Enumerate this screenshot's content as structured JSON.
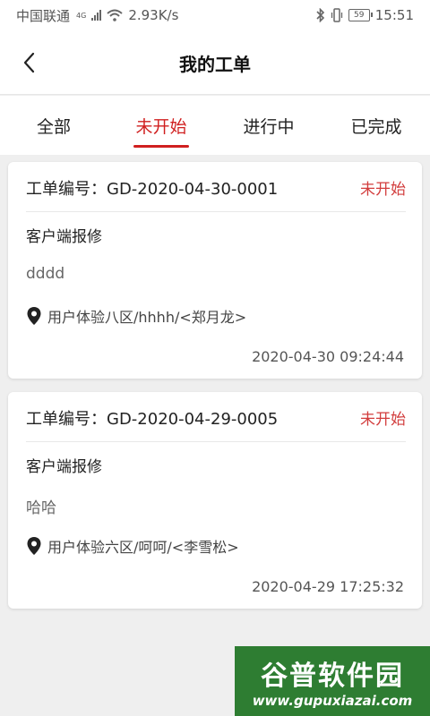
{
  "status_bar": {
    "carrier": "中国联通",
    "network": "4G",
    "speed": "2.93K/s",
    "battery": "59",
    "time": "15:51"
  },
  "header": {
    "title": "我的工单"
  },
  "tabs": [
    {
      "label": "全部",
      "active": false
    },
    {
      "label": "未开始",
      "active": true
    },
    {
      "label": "进行中",
      "active": false
    },
    {
      "label": "已完成",
      "active": false
    }
  ],
  "orders": [
    {
      "number": "工单编号：GD-2020-04-30-0001",
      "status": "未开始",
      "type": "客户端报修",
      "description": "dddd",
      "location": "用户体验八区/hhhh/<郑月龙>",
      "time": "2020-04-30 09:24:44"
    },
    {
      "number": "工单编号：GD-2020-04-29-0005",
      "status": "未开始",
      "type": "客户端报修",
      "description": "哈哈",
      "location": "用户体验六区/呵呵/<李雪松>",
      "time": "2020-04-29 17:25:32"
    }
  ],
  "watermark": {
    "logo": "谷普软件园",
    "url": "www.gupuxiazai.com"
  },
  "colors": {
    "accent": "#d01f1f",
    "status_text": "#d23c3c",
    "background": "#efefef"
  }
}
